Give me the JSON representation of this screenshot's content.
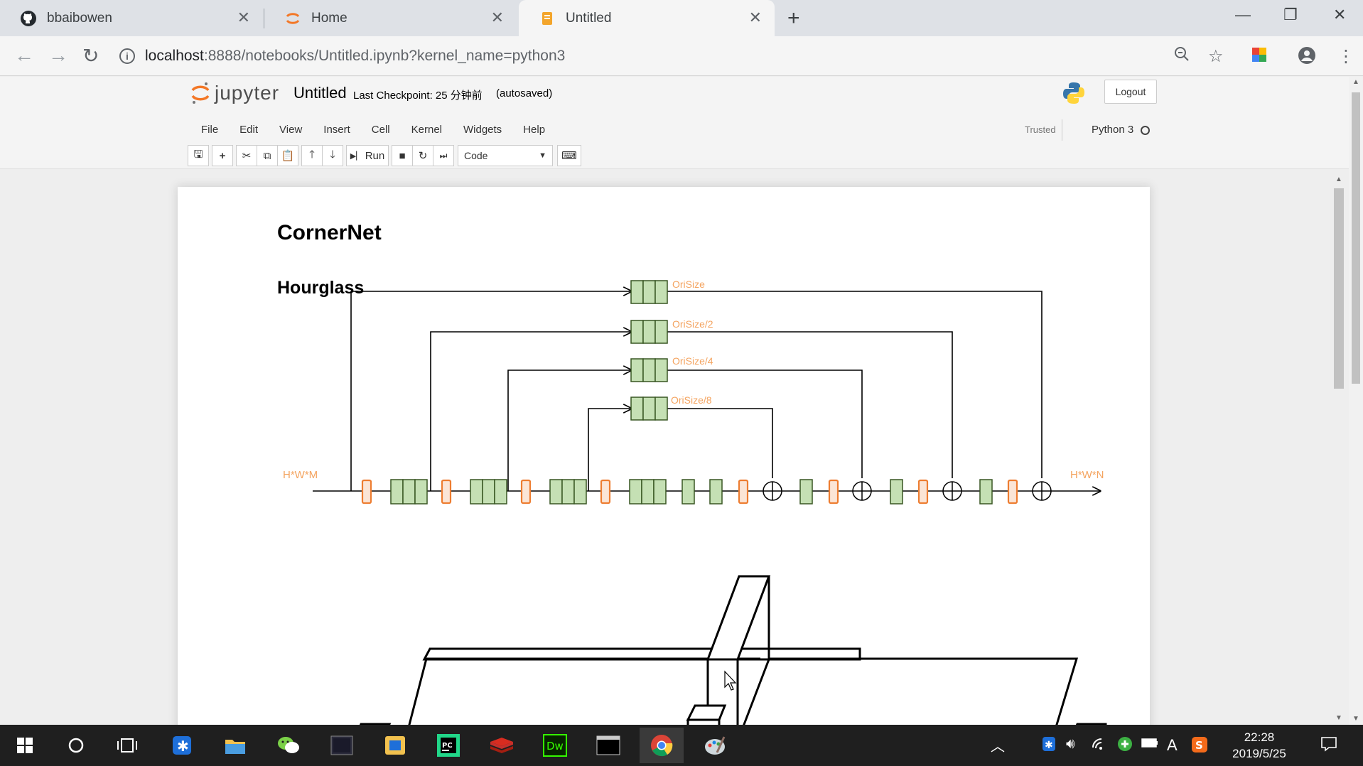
{
  "browser": {
    "tabs": [
      {
        "title": "bbaibowen",
        "icon": "github-icon"
      },
      {
        "title": "Home",
        "icon": "jupyter-icon"
      },
      {
        "title": "Untitled",
        "icon": "notebook-icon",
        "active": true
      }
    ],
    "url_host": "localhost",
    "url_rest": ":8888/notebooks/Untitled.ipynb?kernel_name=python3"
  },
  "jupyter": {
    "logo_text": "jupyter",
    "notebook_name": "Untitled",
    "checkpoint": "Last Checkpoint: 25 分钟前",
    "autosaved": "(autosaved)",
    "logout_label": "Logout",
    "menu": [
      "File",
      "Edit",
      "View",
      "Insert",
      "Cell",
      "Kernel",
      "Widgets",
      "Help"
    ],
    "trusted_label": "Trusted",
    "kernel_name": "Python 3",
    "toolbar": {
      "run_label": "Run",
      "cell_type": "Code",
      "buttons": [
        "save-icon",
        "plus-icon",
        "cut-icon",
        "copy-icon",
        "paste-icon",
        "arrow-up-icon",
        "arrow-down-icon",
        "run-icon",
        "stop-icon",
        "restart-icon",
        "fast-forward-icon",
        "keyboard-icon"
      ]
    }
  },
  "notebook": {
    "heading1": "CornerNet",
    "heading2": "Hourglass",
    "diagram": {
      "input_label": "H*W*M",
      "output_label": "H*W*N",
      "skip_labels": [
        "OriSize",
        "OriSize/2",
        "OriSize/4",
        "OriSize/8"
      ],
      "colors": {
        "green_fill": "#c5e0b4",
        "green_stroke": "#385723",
        "orange": "#f4b183",
        "orange_stroke": "#ed7d31",
        "label": "#f4a460"
      }
    }
  },
  "taskbar": {
    "time": "22:28",
    "date": "2019/5/25",
    "apps": [
      "windows-start-icon",
      "cortana-icon",
      "task-view-icon",
      "bluetooth-app-icon",
      "file-explorer-icon",
      "wechat-icon",
      "terminal-app-icon",
      "outlook-icon",
      "pycharm-icon",
      "redis-icon",
      "dreamweaver-icon",
      "cmd-icon",
      "chrome-icon",
      "paint-icon"
    ]
  }
}
